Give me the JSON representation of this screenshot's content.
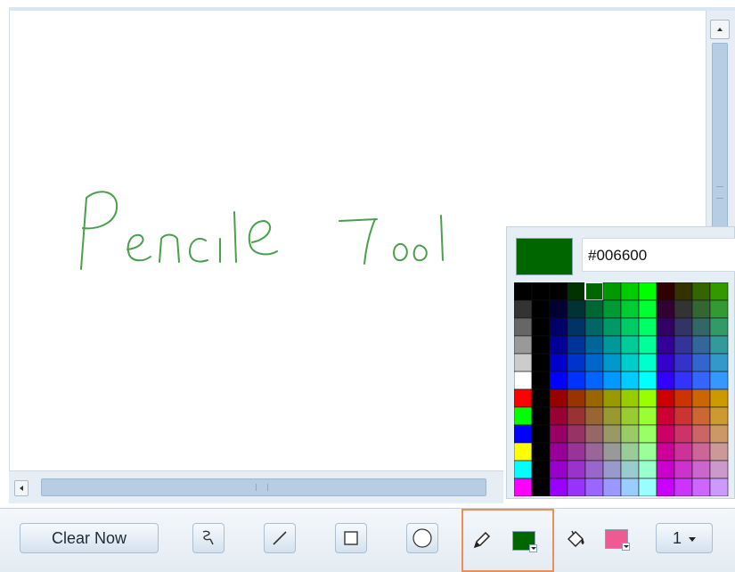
{
  "canvas": {
    "drawing_text": "Pencile Tool",
    "stroke_color": "#49a04c"
  },
  "toolbar": {
    "clear_label": "Clear Now",
    "tools": [
      {
        "name": "freehand-curve-icon",
        "selected": false
      },
      {
        "name": "line-icon",
        "selected": false
      },
      {
        "name": "rectangle-icon",
        "selected": false
      },
      {
        "name": "ellipse-icon",
        "selected": false
      },
      {
        "name": "pencil-icon",
        "selected": true
      },
      {
        "name": "fill-bucket-icon",
        "selected": false
      }
    ],
    "stroke_color": "#006600",
    "fill_color": "#ee5a92",
    "size_value": "1"
  },
  "color_picker": {
    "hex_value": "#006600",
    "selected_color": "#006600"
  }
}
